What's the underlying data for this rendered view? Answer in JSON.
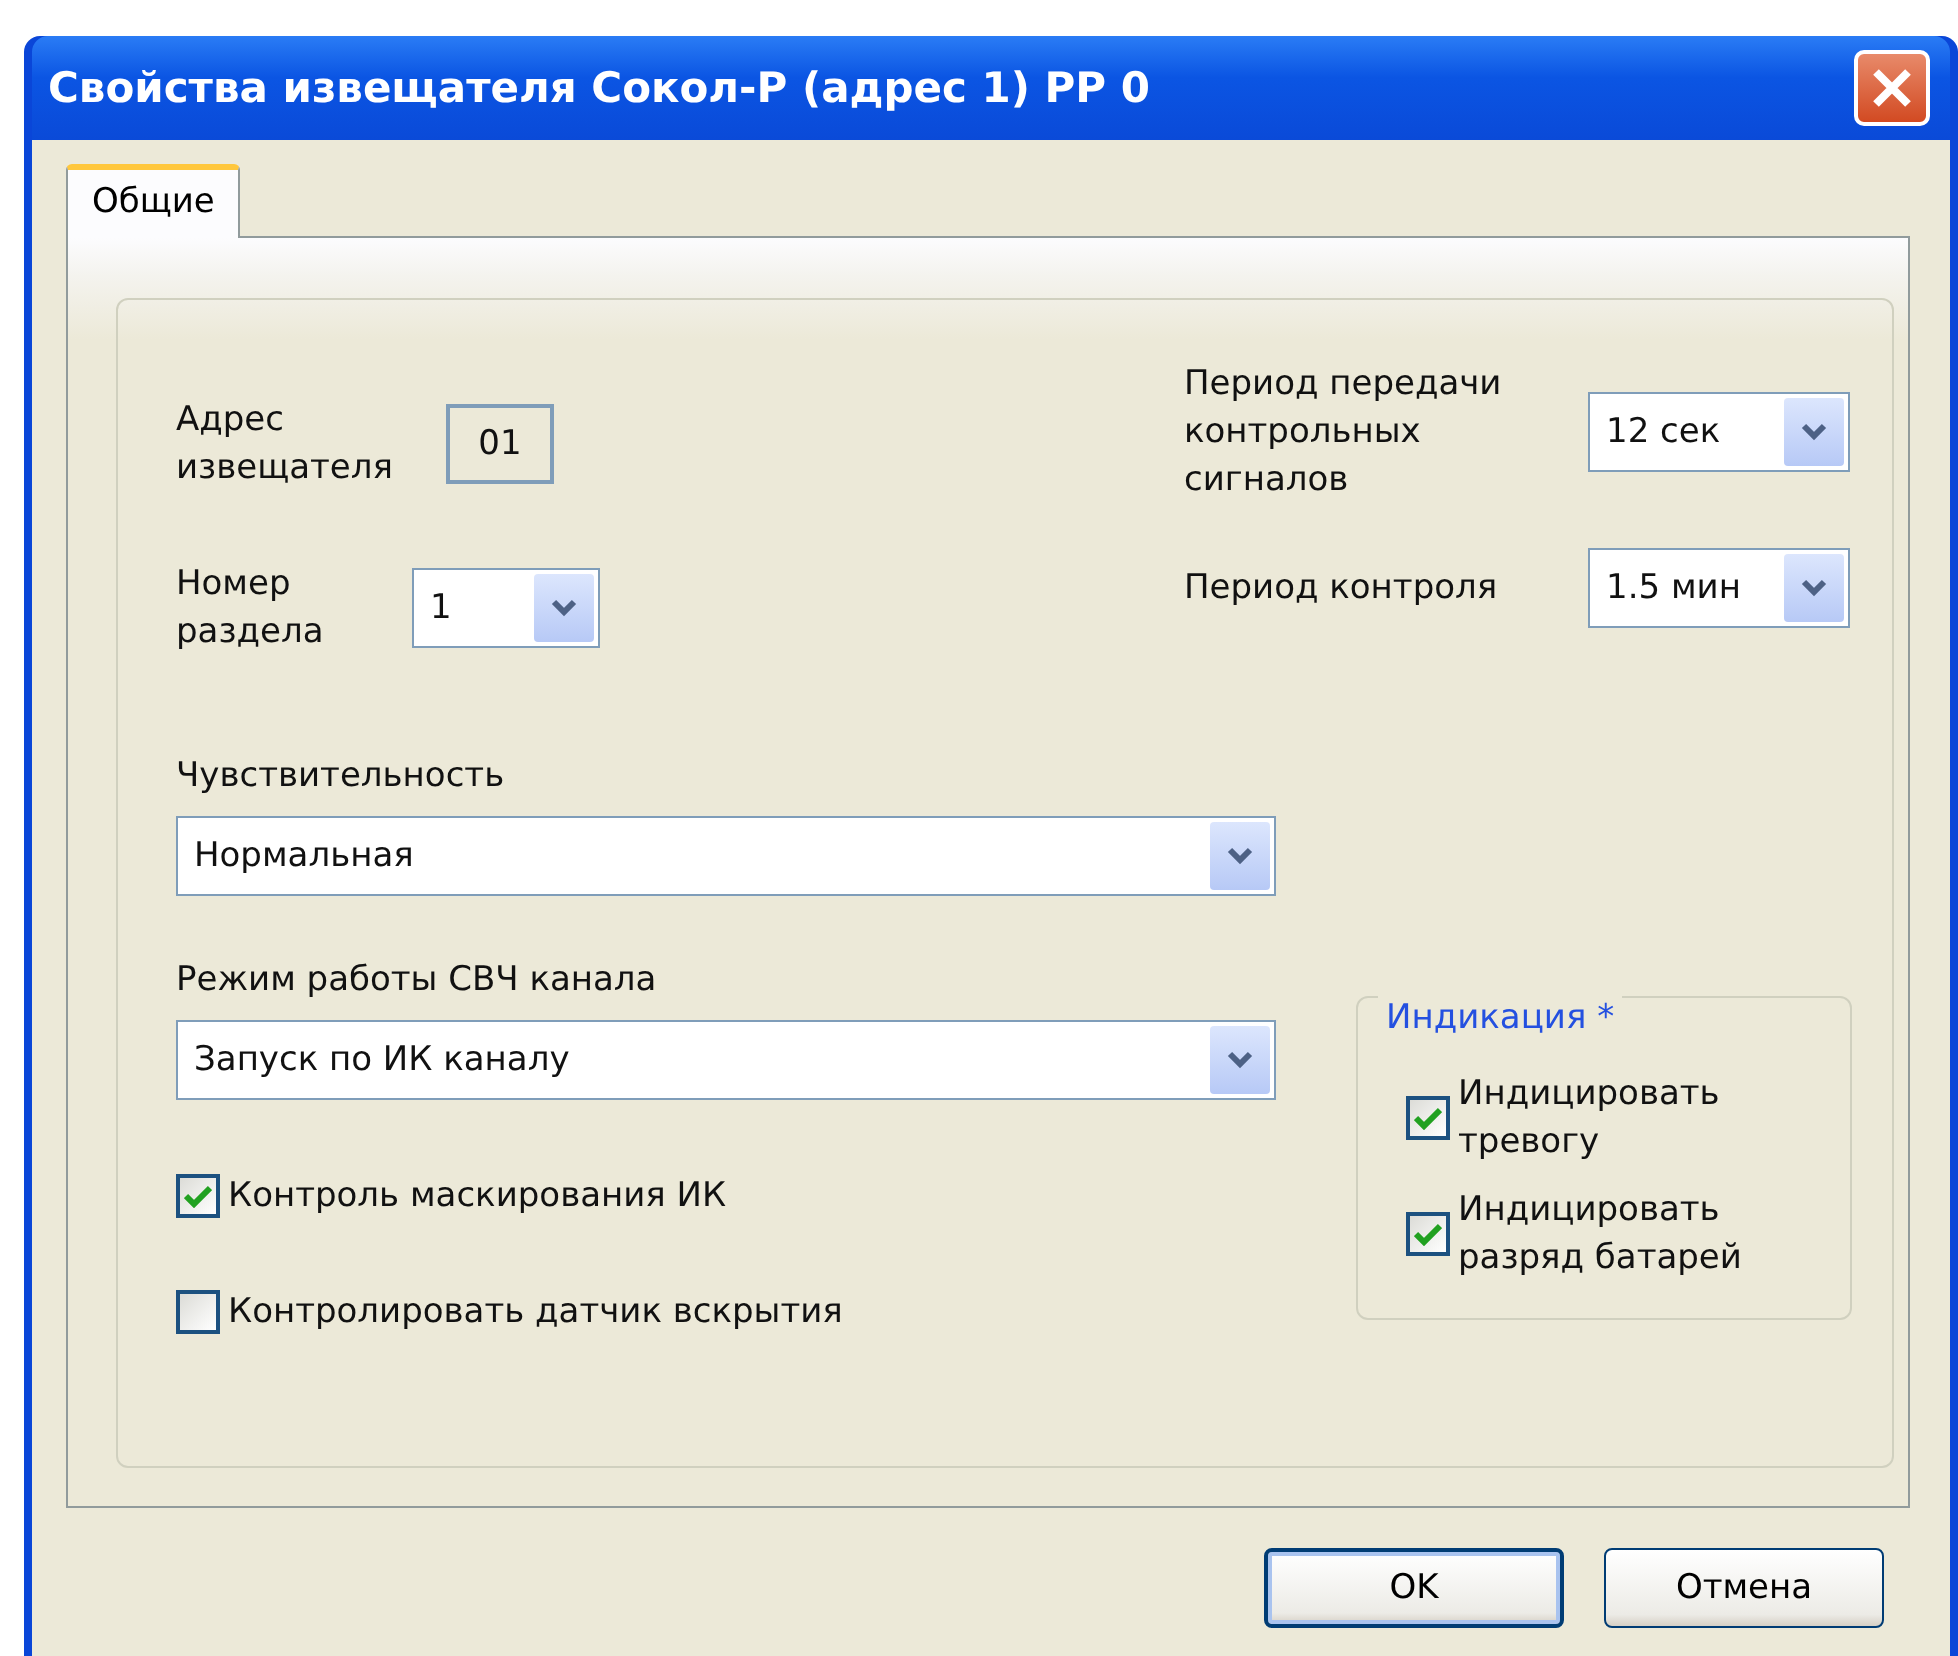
{
  "window": {
    "title": "Свойства извещателя Сокол-Р (адрес 1) РР 0"
  },
  "tabs": [
    {
      "label": "Общие",
      "selected": true
    }
  ],
  "address": {
    "label": "Адрес извещателя",
    "value": "01"
  },
  "partition": {
    "label": "Номер раздела",
    "value": "1"
  },
  "transmit_period": {
    "label": "Период передачи контрольных сигналов",
    "value": "12 сек"
  },
  "control_period": {
    "label": "Период контроля",
    "value": "1.5 мин"
  },
  "sensitivity": {
    "label": "Чувствительность",
    "value": "Нормальная"
  },
  "mw_mode": {
    "label": "Режим работы СВЧ канала",
    "value": "Запуск по ИК каналу"
  },
  "checkboxes": [
    {
      "label": "Контроль маскирования ИК",
      "checked": true
    },
    {
      "label": "Контролировать датчик вскрытия",
      "checked": false
    }
  ],
  "indication": {
    "title": "Индикация *",
    "items": [
      {
        "label": "Индицировать тревогу",
        "checked": true
      },
      {
        "label": "Индицировать разряд батарей",
        "checked": true
      }
    ]
  },
  "buttons": [
    "OK",
    "Отмена"
  ]
}
